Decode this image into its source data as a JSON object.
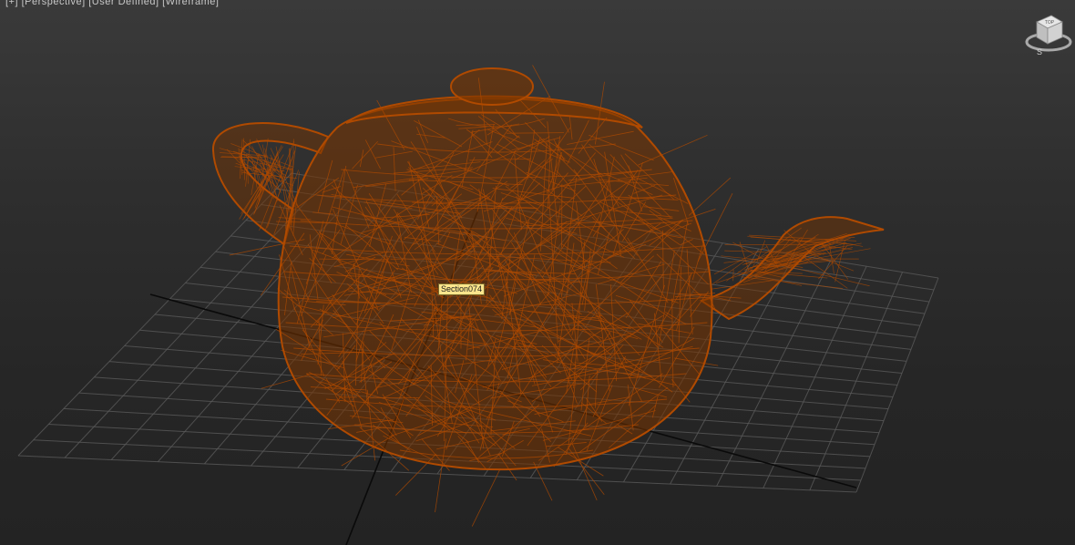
{
  "viewport": {
    "label": "[+] [Perspective] [User Defined] [Wireframe]",
    "background_color": "#2e2e2e",
    "grid_color": "#5a5a5a",
    "axis_color": "#0a0a0a"
  },
  "object": {
    "name": "Section074",
    "wire_color": "#b04a00",
    "fill_color": "#7a3500",
    "icon": "teapot-wireframe"
  },
  "viewcube": {
    "icon": "viewcube-icon",
    "face_label": "TOP",
    "compass_label": "S"
  }
}
